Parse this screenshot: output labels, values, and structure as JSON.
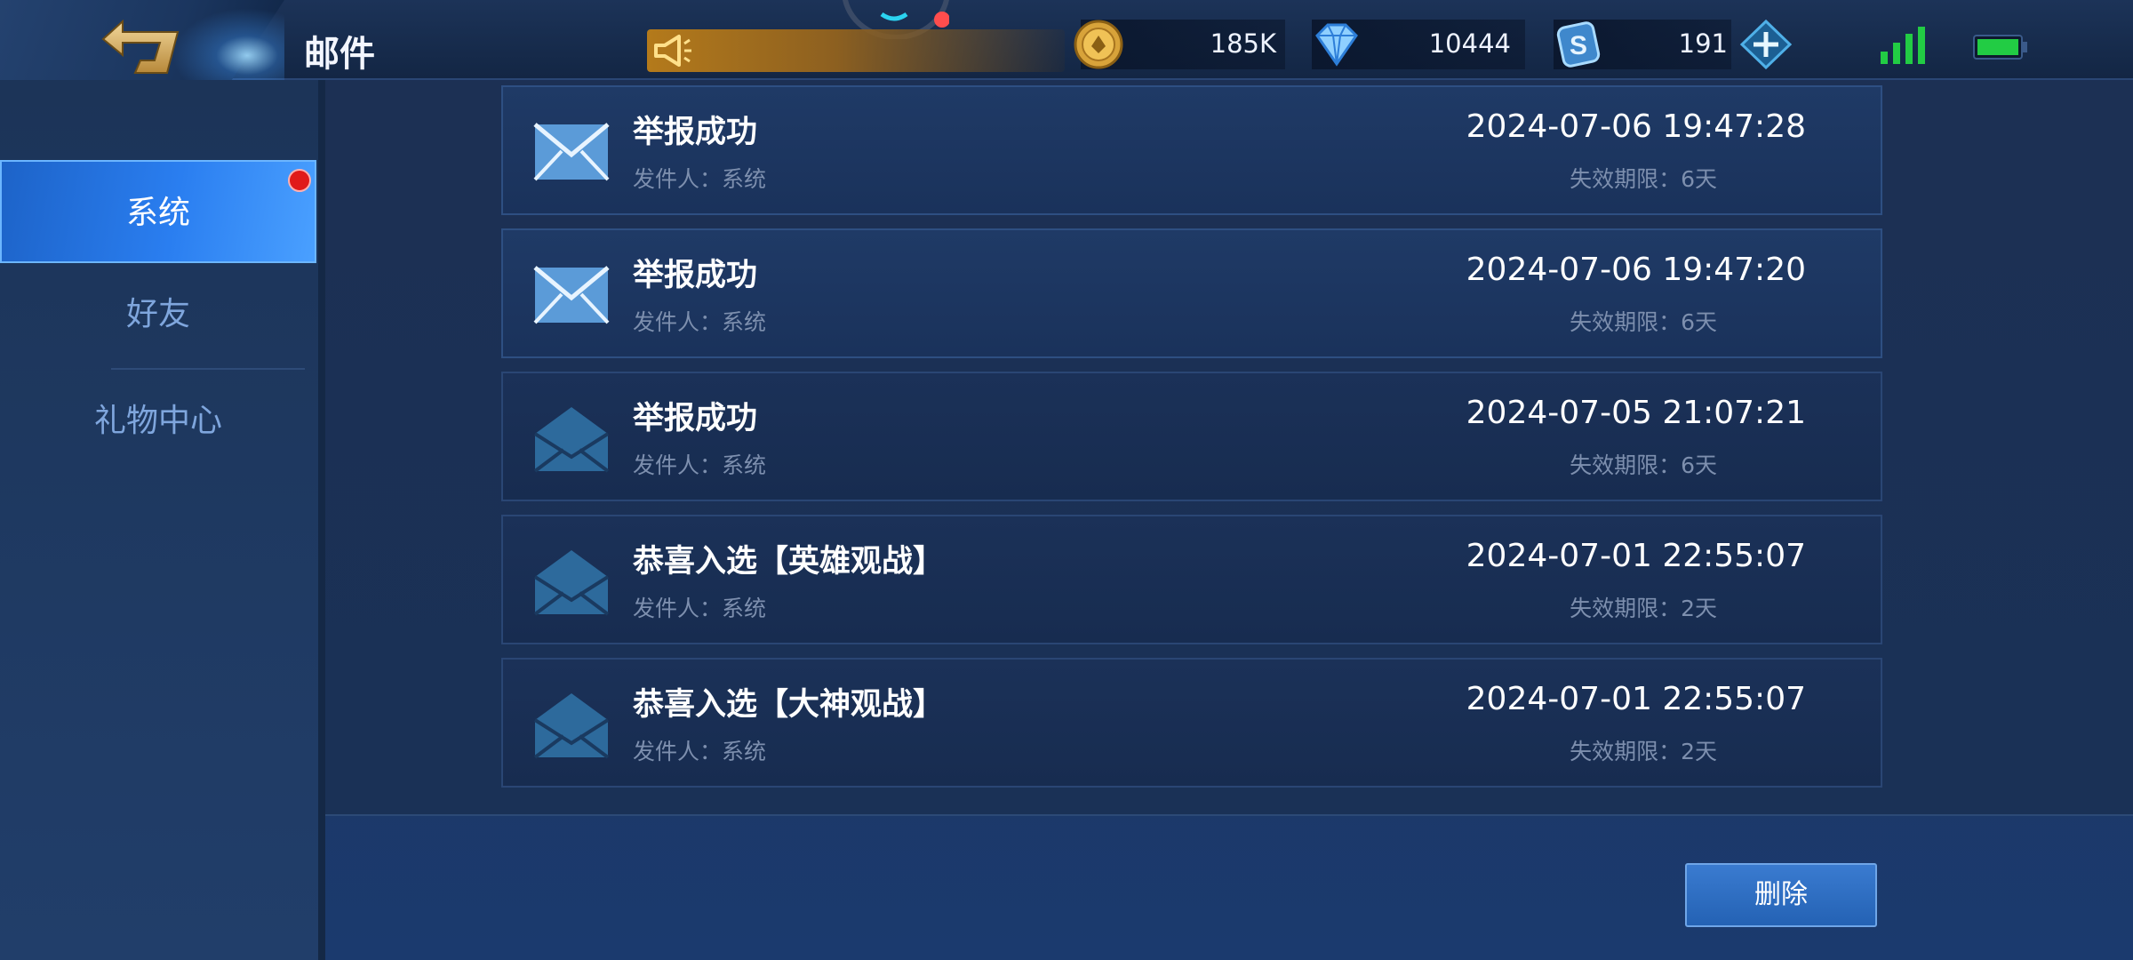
{
  "header": {
    "title": "邮件",
    "back_icon": "back-arrow-icon",
    "announce_icon": "megaphone-icon"
  },
  "resources": {
    "gold": {
      "icon": "gold-coin-icon",
      "value": "185K"
    },
    "diamond": {
      "icon": "diamond-icon",
      "value": "10444"
    },
    "voucher": {
      "icon": "s-voucher-icon",
      "value": "191"
    },
    "add_icon": "plus-icon"
  },
  "status": {
    "signal_icon": "signal-icon",
    "battery_icon": "battery-icon",
    "battery_color": "#22cc44"
  },
  "sidebar": {
    "items": [
      {
        "label": "系统",
        "active": true,
        "has_badge": true
      },
      {
        "label": "好友",
        "active": false
      },
      {
        "label": "礼物中心",
        "active": false
      }
    ]
  },
  "mails": [
    {
      "title": "举报成功",
      "sender": "发件人：系统",
      "time": "2024-07-06 19:47:28",
      "expiry": "失效期限：6天",
      "read": false
    },
    {
      "title": "举报成功",
      "sender": "发件人：系统",
      "time": "2024-07-06 19:47:20",
      "expiry": "失效期限：6天",
      "read": false
    },
    {
      "title": "举报成功",
      "sender": "发件人：系统",
      "time": "2024-07-05 21:07:21",
      "expiry": "失效期限：6天",
      "read": true
    },
    {
      "title": "恭喜入选【英雄观战】",
      "sender": "发件人：系统",
      "time": "2024-07-01 22:55:07",
      "expiry": "失效期限：2天",
      "read": true
    },
    {
      "title": "恭喜入选【大神观战】",
      "sender": "发件人：系统",
      "time": "2024-07-01 22:55:07",
      "expiry": "失效期限：2天",
      "read": true
    }
  ],
  "actions": {
    "delete_label": "删除"
  },
  "colors": {
    "accent": "#2a7ef0",
    "badge": "#e01a1a",
    "gold": "#d8a33a"
  }
}
